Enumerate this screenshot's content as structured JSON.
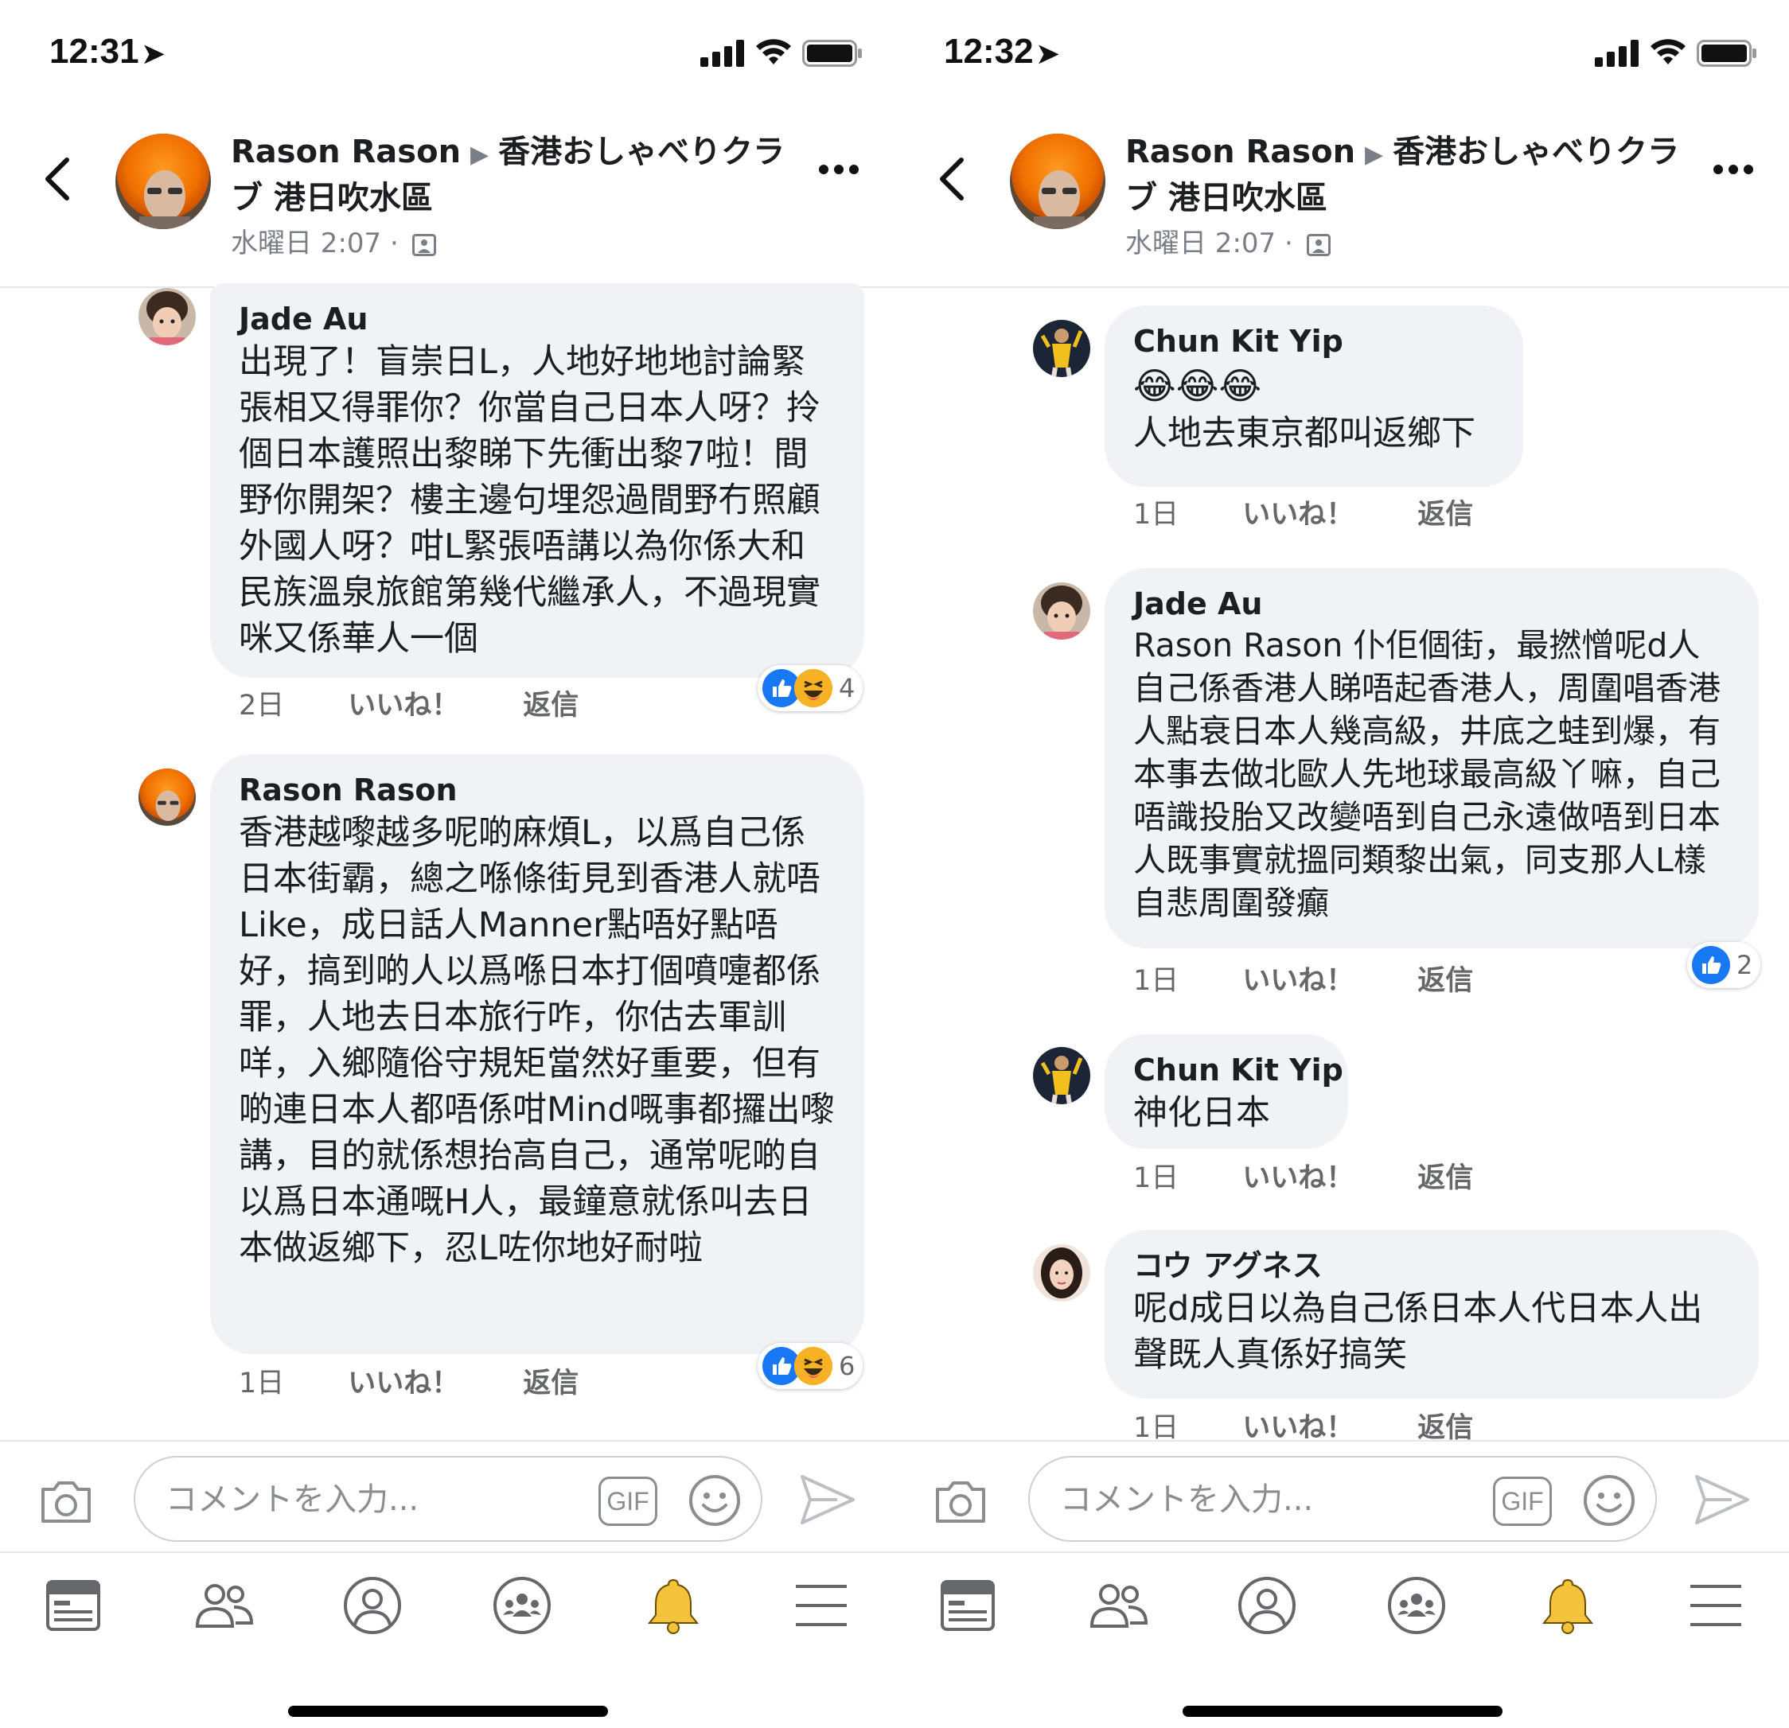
{
  "screens": [
    {
      "status": {
        "time": "12:31"
      },
      "header": {
        "author": "Rason Rason",
        "group": "香港おしゃべりクラブ 港日吹水區",
        "timestamp": "水曜日 2:07"
      },
      "comments": [
        {
          "author": "Jade Au",
          "text": "出現了！盲崇日L，人地好地地討論緊張相又得罪你？你當自己日本人呀？拎個日本護照出黎睇下先衝出黎7啦！間野你開架？樓主邊句埋怨過間野冇照顧外國人呀？咁L緊張唔講以為你係大和民族溫泉旅館第幾代繼承人，不過現實咪又係華人一個",
          "time": "2日",
          "like": "いいね！",
          "reply": "返信",
          "reaction_count": "4"
        },
        {
          "author": "Rason Rason",
          "text": "香港越嚟越多呢啲麻煩L，以爲自己係日本街霸，總之喺條街見到香港人就唔Like，成日話人Manner點唔好點唔好，搞到啲人以爲喺日本打個噴嚏都係罪，人地去日本旅行咋，你估去軍訓咩，入鄉隨俗守規矩當然好重要，但有啲連日本人都唔係咁Mind嘅事都攞出嚟講，目的就係想抬高自己，通常呢啲自以爲日本通嘅H人，最鐘意就係叫去日本做返鄉下，忍L咗你地好耐啦",
          "time": "1日",
          "like": "いいね！",
          "reply": "返信",
          "reaction_count": "6"
        }
      ],
      "composer": {
        "placeholder": "コメントを入力...",
        "gif": "GIF"
      }
    },
    {
      "status": {
        "time": "12:32"
      },
      "header": {
        "author": "Rason Rason",
        "group": "香港おしゃべりクラブ 港日吹水區",
        "timestamp": "水曜日 2:07"
      },
      "comments": [
        {
          "author": "Chun Kit Yip",
          "emoji": "😂😂😂",
          "text": "人地去東京都叫返鄉下",
          "time": "1日",
          "like": "いいね！",
          "reply": "返信"
        },
        {
          "author": "Jade Au",
          "text": "Rason Rason 仆佢個街，最撚憎呢d人自己係香港人睇唔起香港人，周圍唱香港人點衰日本人幾高級，井底之蛙到爆，有本事去做北歐人先地球最高級丫嘛，自己唔識投胎又改變唔到自己永遠做唔到日本人既事實就搵同類黎出氣，同支那人L樣自悲周圍發癲",
          "time": "1日",
          "like": "いいね！",
          "reply": "返信",
          "reaction_count": "2"
        },
        {
          "author": "Chun Kit Yip",
          "text": "神化日本",
          "time": "1日",
          "like": "いいね！",
          "reply": "返信"
        },
        {
          "author": "コウ アグネス",
          "text": "呢d成日以為自己係日本人代日本人出聲既人真係好搞笑",
          "time": "1日",
          "like": "いいね！",
          "reply": "返信"
        }
      ],
      "composer": {
        "placeholder": "コメントを入力...",
        "gif": "GIF"
      }
    }
  ],
  "colors": {
    "like_blue": "#1877f2",
    "haha_yellow": "#f7b125",
    "bubble_gray": "#f0f2f5",
    "bell_yellow": "#f5c33b"
  },
  "nav_icons": [
    "news-feed-icon",
    "friends-icon",
    "profile-icon",
    "groups-icon",
    "notifications-bell-icon",
    "menu-icon"
  ]
}
